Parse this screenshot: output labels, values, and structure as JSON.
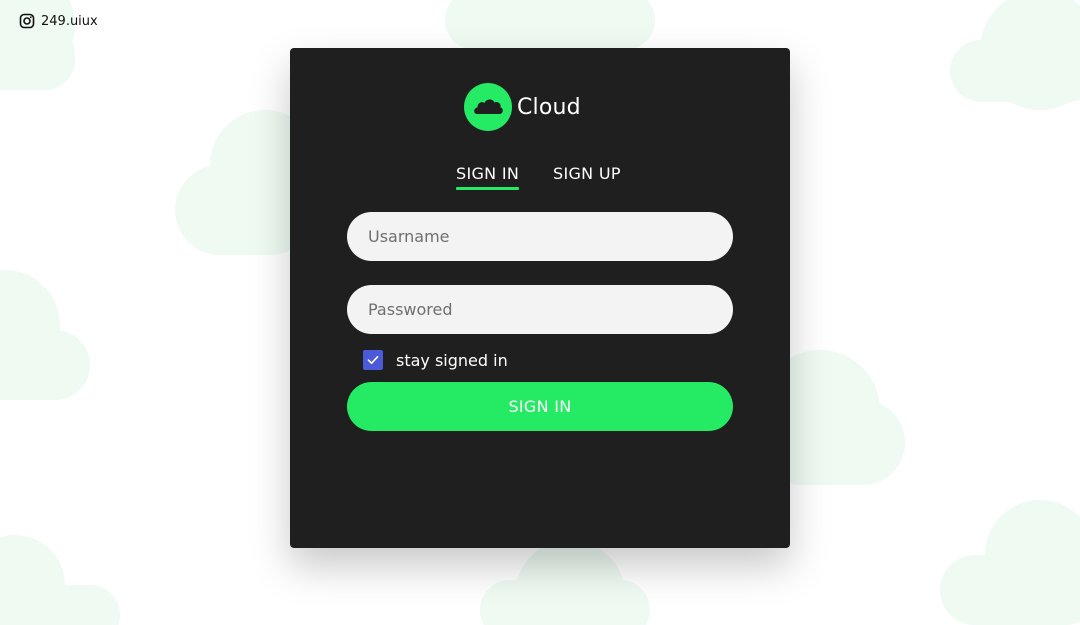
{
  "watermark": {
    "handle": "249.uiux",
    "icon": "instagram-icon"
  },
  "brand": {
    "name": "Cloud",
    "icon": "cloud-icon",
    "accent_color": "#25eb64"
  },
  "tabs": [
    {
      "label": "SIGN IN",
      "active": true
    },
    {
      "label": "SIGN UP",
      "active": false
    }
  ],
  "form": {
    "username": {
      "placeholder": "Usarname",
      "value": ""
    },
    "password": {
      "placeholder": "Passwored",
      "value": ""
    },
    "remember": {
      "label": "stay signed in",
      "checked": true,
      "color": "#4a5ad8"
    },
    "submit_label": "SIGN IN"
  },
  "colors": {
    "card_background": "#1f1f1f",
    "page_background": "#ffffff",
    "background_clouds": "#eefaf2"
  }
}
